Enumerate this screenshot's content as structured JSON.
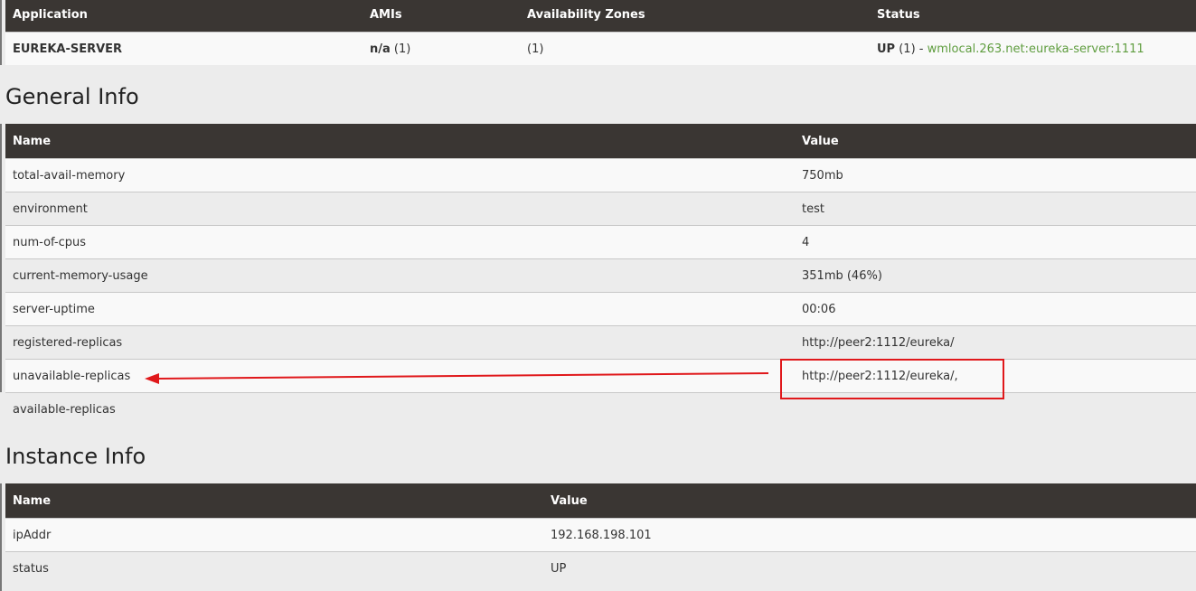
{
  "apps": {
    "headers": [
      "Application",
      "AMIs",
      "Availability Zones",
      "Status"
    ],
    "row": {
      "application": "EUREKA-SERVER",
      "amis_value": "n/a",
      "amis_count": "(1)",
      "zones": "(1)",
      "status_value": "UP",
      "status_count": "(1)",
      "status_sep": "-",
      "status_link": "wmlocal.263.net:eureka-server:1111"
    }
  },
  "general_info": {
    "title": "General Info",
    "headers": [
      "Name",
      "Value"
    ],
    "rows": [
      {
        "name": "total-avail-memory",
        "value": "750mb"
      },
      {
        "name": "environment",
        "value": "test"
      },
      {
        "name": "num-of-cpus",
        "value": "4"
      },
      {
        "name": "current-memory-usage",
        "value": "351mb (46%)"
      },
      {
        "name": "server-uptime",
        "value": "00:06"
      },
      {
        "name": "registered-replicas",
        "value": "http://peer2:1112/eureka/"
      },
      {
        "name": "unavailable-replicas",
        "value": "http://peer2:1112/eureka/,"
      },
      {
        "name": "available-replicas",
        "value": ""
      }
    ]
  },
  "instance_info": {
    "title": "Instance Info",
    "headers": [
      "Name",
      "Value"
    ],
    "rows": [
      {
        "name": "ipAddr",
        "value": "192.168.198.101"
      },
      {
        "name": "status",
        "value": "UP"
      }
    ]
  },
  "colors": {
    "header_bg": "#3a3633",
    "link_green": "#5f9d3f",
    "annotation_red": "#e0181b"
  }
}
